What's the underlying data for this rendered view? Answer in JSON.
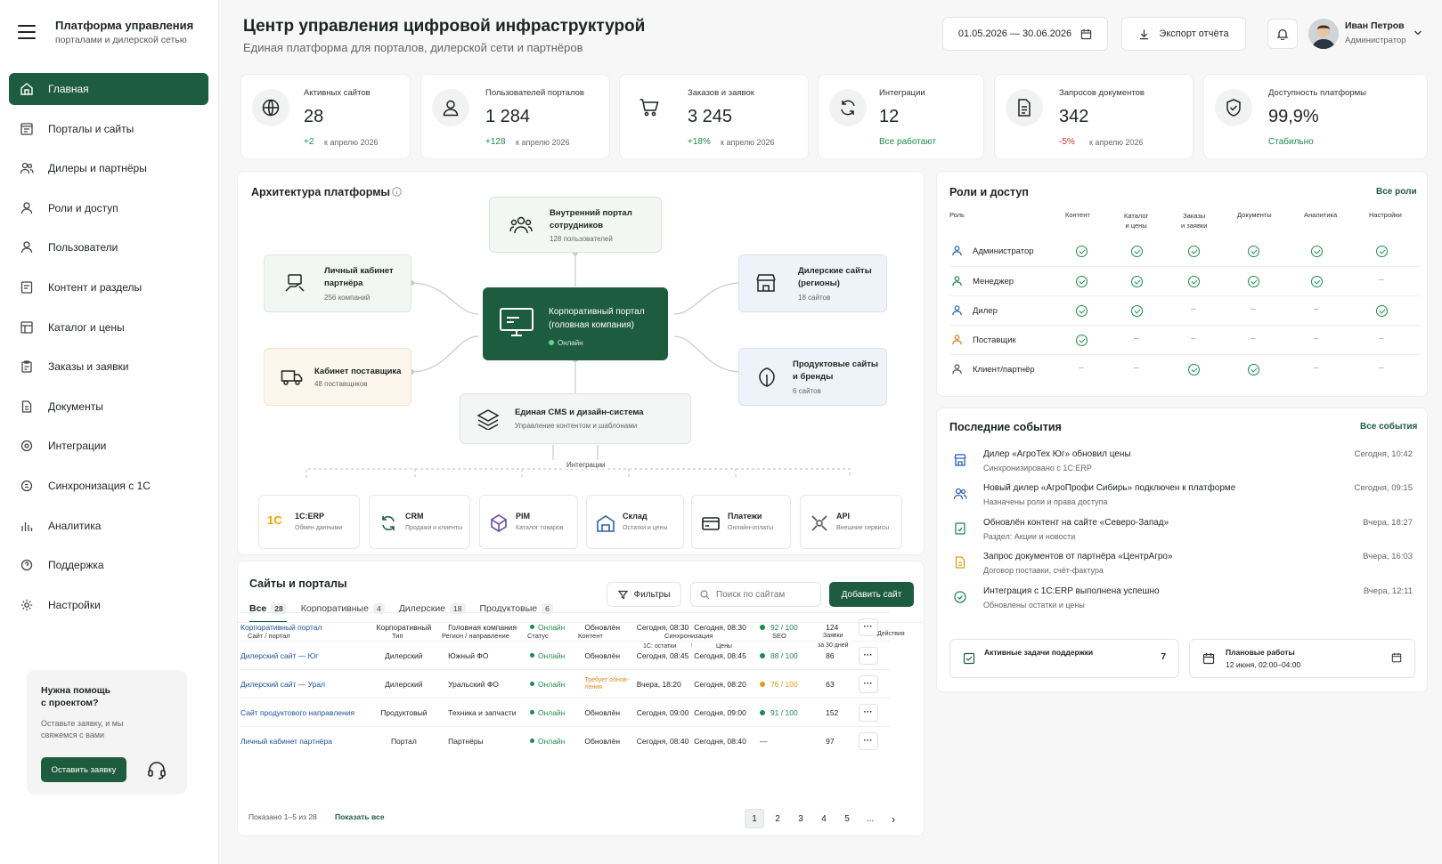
{
  "brand": {
    "title": "Платформа управления",
    "subtitle": "порталами и дилерской сетью"
  },
  "nav": [
    "Главная",
    "Порталы и сайты",
    "Дилеры и партнёры",
    "Роли и доступ",
    "Пользователи",
    "Контент и разделы",
    "Каталог и цены",
    "Заказы и заявки",
    "Документы",
    "Интеграции",
    "Синхронизация с 1С",
    "Аналитика",
    "Поддержка",
    "Настройки"
  ],
  "help": {
    "title": "Нужна помощь\nс проектом?",
    "text": "Оставьте заявку, и мы\nсвяжемся с вами",
    "button": "Оставить заявку"
  },
  "header": {
    "title": "Центр управления цифровой инфраструктурой",
    "subtitle": "Единая платформа для порталов, дилерской сети и партнёров",
    "date_range": "01.05.2026 — 30.06.2026",
    "export": "Экспорт отчёта",
    "user_name": "Иван Петров",
    "user_role": "Администратор"
  },
  "kpi": [
    {
      "label": "Активных сайтов",
      "value": "28",
      "delta": "+2",
      "period": "к апрелю 2026",
      "icon": "globe-icon"
    },
    {
      "label": "Пользователей порталов",
      "value": "1 284",
      "delta": "+128",
      "period": "к апрелю 2026",
      "icon": "user-icon"
    },
    {
      "label": "Заказов и заявок",
      "value": "3 245",
      "delta": "+18%",
      "period": "к апрелю 2026",
      "icon": "cart-icon"
    },
    {
      "label": "Интеграции",
      "value": "12",
      "delta": "Все работают",
      "period": "",
      "icon": "sync-icon"
    },
    {
      "label": "Запросов документов",
      "value": "342",
      "delta": "-5%",
      "period": "к апрелю 2026",
      "icon": "document-icon"
    },
    {
      "label": "Доступность платформы",
      "value": "99,9%",
      "delta": "Стабильно",
      "period": "",
      "icon": "shield-icon"
    }
  ],
  "arch": {
    "title": "Архитектура платформы",
    "center": {
      "title": "Корпоративный портал\n(головная компания)",
      "status": "Онлайн"
    },
    "employees": {
      "title": "Внутренний портал\nсотрудников",
      "sub": "128 пользователей"
    },
    "partner_cab": {
      "title": "Личный кабинет\nпартнёра",
      "sub": "256 компаний"
    },
    "supplier_cab": {
      "title": "Кабинет поставщика",
      "sub": "48 поставщиков"
    },
    "dealer_sites": {
      "title": "Дилерские сайты\n(регионы)",
      "sub": "18 сайтов"
    },
    "product_sites": {
      "title": "Продуктовые сайты\nи бренды",
      "sub": "6 сайтов"
    },
    "cms": {
      "title": "Единая CMS и дизайн-система",
      "sub": "Управление контентом и шаблонами"
    },
    "integrations_label": "Интеграции",
    "systems": [
      {
        "title": "1С:ERP",
        "sub": "Обмен данными"
      },
      {
        "title": "CRM",
        "sub": "Продажи и клиенты"
      },
      {
        "title": "PIM",
        "sub": "Каталог товаров"
      },
      {
        "title": "Склад",
        "sub": "Остатки и цены"
      },
      {
        "title": "Платежи",
        "sub": "Онлайн-оплаты"
      },
      {
        "title": "API",
        "sub": "Внешние сервисы"
      }
    ]
  },
  "roles": {
    "title": "Роли и доступ",
    "link": "Все роли",
    "columns": [
      "Роль",
      "Контент",
      "Каталог\nи цены",
      "Заказы\nи заявки",
      "Документы",
      "Аналитика",
      "Настройки"
    ],
    "rows": [
      {
        "name": "Администратор",
        "access": [
          1,
          1,
          1,
          1,
          1,
          1
        ]
      },
      {
        "name": "Менеджер",
        "access": [
          1,
          1,
          1,
          1,
          1,
          0
        ]
      },
      {
        "name": "Дилер",
        "access": [
          1,
          1,
          0,
          0,
          0,
          1
        ]
      },
      {
        "name": "Поставщик",
        "access": [
          1,
          0,
          0,
          0,
          0,
          0
        ]
      },
      {
        "name": "Клиент/партнёр",
        "access": [
          0,
          0,
          1,
          1,
          0,
          0
        ]
      }
    ]
  },
  "events": {
    "title": "Последние события",
    "link": "Все события",
    "items": [
      {
        "title": "Дилер «АгроТех Юг» обновил цены",
        "sub": "Синхронизировано с 1С:ERP",
        "time": "Сегодня, 10:42"
      },
      {
        "title": "Новый дилер «АгроПрофи Сибирь» подключен к платформе",
        "sub": "Назначены роли и права доступа",
        "time": "Сегодня, 09:15"
      },
      {
        "title": "Обновлён контент на сайте «Северо-Запад»",
        "sub": "Раздел: Акции и новости",
        "time": "Вчера, 18:27"
      },
      {
        "title": "Запрос документов от партнёра «ЦентрАгро»",
        "sub": "Договор поставки, счёт-фактура",
        "time": "Вчера, 16:03"
      },
      {
        "title": "Интеграция с 1С:ERP выполнена успешно",
        "sub": "Обновлены остатки и цены",
        "time": "Вчера, 12:11"
      }
    ],
    "support": {
      "label": "Активные задачи поддержки",
      "count": "7"
    },
    "maint": {
      "label": "Плановые работы",
      "date": "12 июня, 02:00–04:00"
    }
  },
  "sites": {
    "title": "Сайты и порталы",
    "filters": "Фильтры",
    "search_placeholder": "Поиск по сайтам",
    "add": "Добавить сайт",
    "tabs": [
      {
        "label": "Все",
        "count": "28"
      },
      {
        "label": "Корпоративные",
        "count": "4"
      },
      {
        "label": "Дилерские",
        "count": "18"
      },
      {
        "label": "Продуктовые",
        "count": "6"
      }
    ],
    "columns": {
      "site": "Сайт / портал",
      "type": "Тип",
      "region": "Регион / направление",
      "status": "Статус",
      "content": "Контент",
      "sync": "Синхронизация",
      "sync_stock": "1С: остатки",
      "sync_price": "Цены",
      "seo": "SEO",
      "orders": "Заявки\nза 30 дней",
      "actions": "Действия"
    },
    "rows": [
      {
        "site": "Корпоративный портал",
        "type": "Корпоративный",
        "region": "Головная компания",
        "status": "Онлайн",
        "content": "Обновлён",
        "stock": "Сегодня, 08:30",
        "price": "Сегодня, 08:30",
        "seo": "92 / 100",
        "orders": "124",
        "warn": false
      },
      {
        "site": "Дилерский сайт — Юг",
        "type": "Дилерский",
        "region": "Южный ФО",
        "status": "Онлайн",
        "content": "Обновлён",
        "stock": "Сегодня, 08:45",
        "price": "Сегодня, 08:45",
        "seo": "88 / 100",
        "orders": "86",
        "warn": false
      },
      {
        "site": "Дилерский сайт — Урал",
        "type": "Дилерский",
        "region": "Уральский ФО",
        "status": "Онлайн",
        "content": "Требует обнов-\nления",
        "stock": "Вчера, 18:20",
        "price": "Сегодня, 08:20",
        "seo": "76 / 100",
        "orders": "63",
        "warn": true
      },
      {
        "site": "Сайт продуктового направления",
        "type": "Продуктовый",
        "region": "Техника и запчасти",
        "status": "Онлайн",
        "content": "Обновлён",
        "stock": "Сегодня, 09:00",
        "price": "Сегодня, 09:00",
        "seo": "91 / 100",
        "orders": "152",
        "warn": false
      },
      {
        "site": "Личный кабинет партнёра",
        "type": "Портал",
        "region": "Партнёры",
        "status": "Онлайн",
        "content": "Обновлён",
        "stock": "Сегодня, 08:40",
        "price": "Сегодня, 08:40",
        "seo": "—",
        "orders": "97",
        "warn": false
      }
    ],
    "footer": "Показано 1–5 из 28",
    "show_all": "Показать все",
    "pages": [
      "1",
      "2",
      "3",
      "4",
      "5",
      "...",
      "›"
    ]
  }
}
